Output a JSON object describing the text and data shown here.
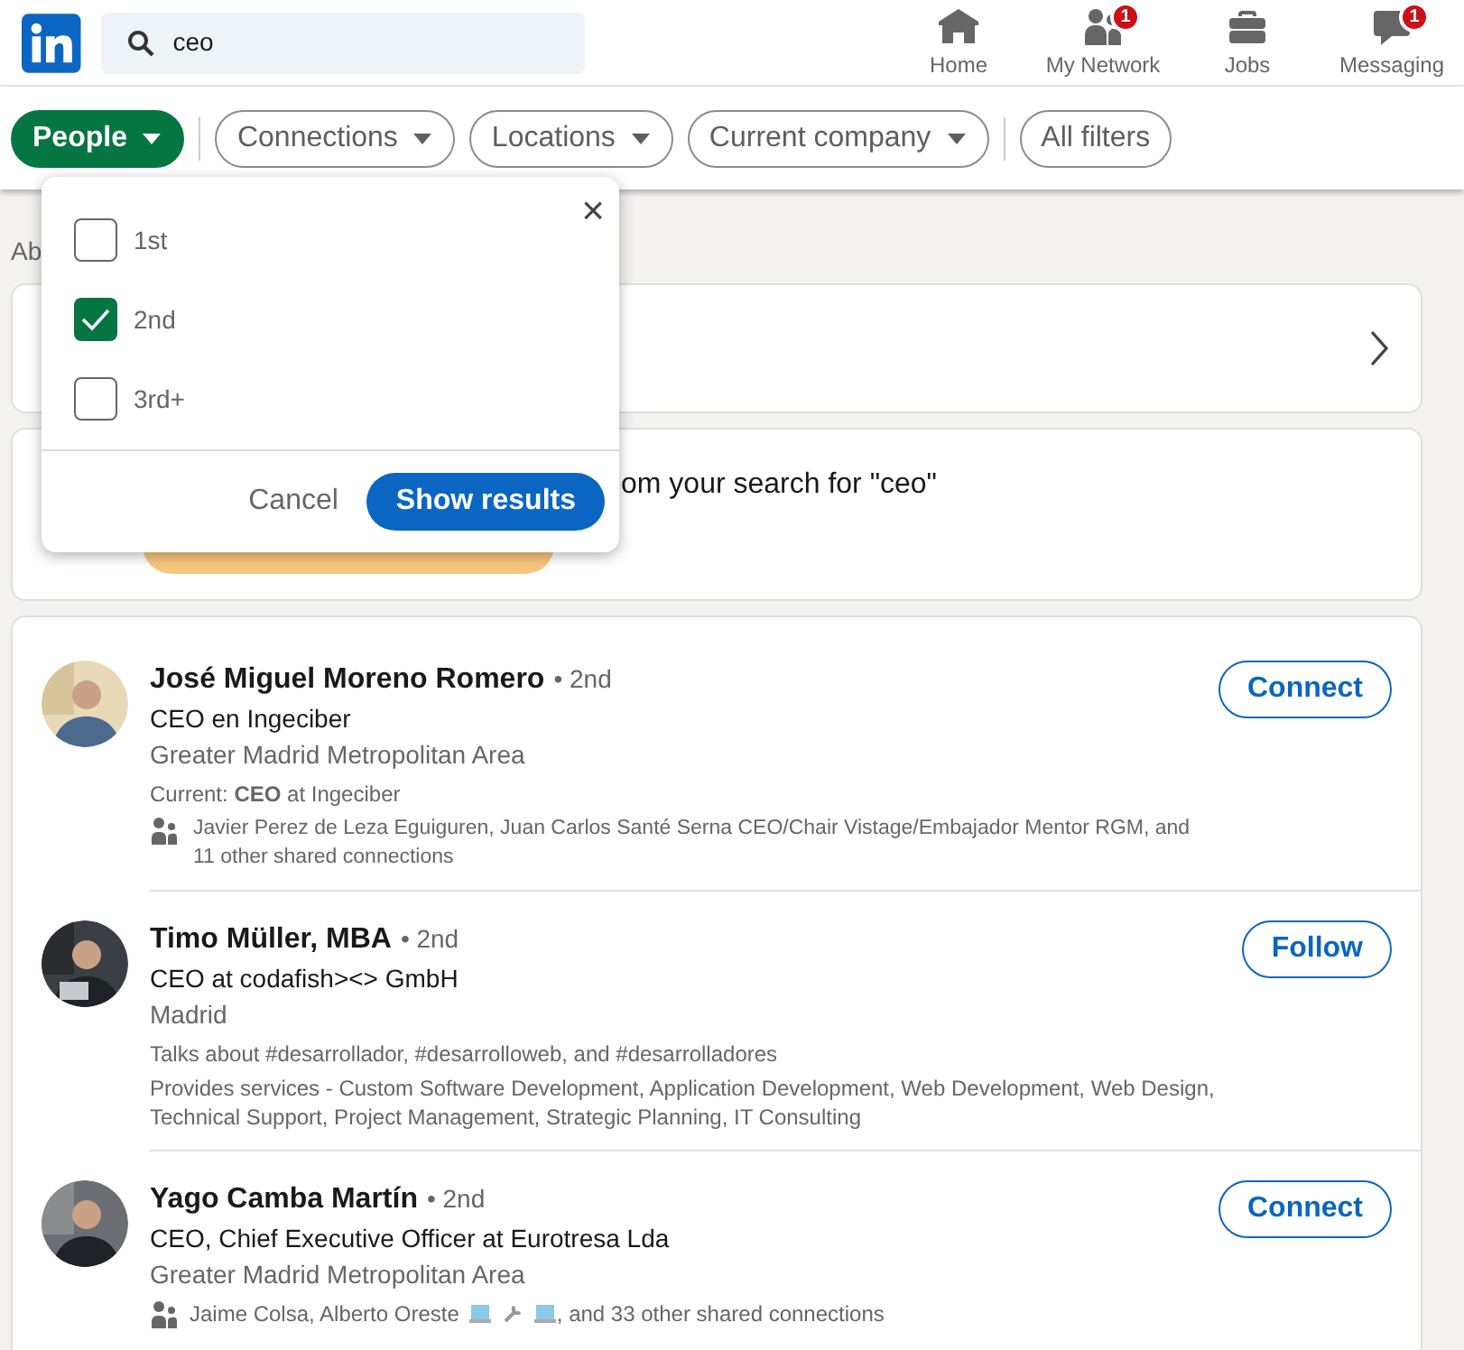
{
  "header": {
    "search": {
      "value": "ceo"
    },
    "nav": [
      {
        "label": "Home"
      },
      {
        "label": "My Network",
        "badge": "1"
      },
      {
        "label": "Jobs"
      },
      {
        "label": "Messaging",
        "badge": "1"
      }
    ]
  },
  "filters": [
    {
      "label": "People",
      "selected": true,
      "caret": true
    },
    {
      "label": "Connections",
      "selected": false,
      "caret": true
    },
    {
      "label": "Locations",
      "selected": false,
      "caret": true
    },
    {
      "label": "Current company",
      "selected": false,
      "caret": true
    },
    {
      "label": "All filters",
      "selected": false,
      "caret": false
    }
  ],
  "dropdown": {
    "close": "×",
    "options": [
      {
        "label": "1st",
        "checked": false
      },
      {
        "label": "2nd",
        "checked": true
      },
      {
        "label": "3rd+",
        "checked": false
      }
    ],
    "cancel": "Cancel",
    "submit": "Show results"
  },
  "results_count_partial": "Ab",
  "promo_text_partial": "om your search for \"ceo\"",
  "results": [
    {
      "name": "José Miguel Moreno Romero",
      "degree": "• 2nd",
      "headline": "CEO en Ingeciber",
      "location": "Greater Madrid Metropolitan Area",
      "action": "Connect",
      "lines": [
        {
          "kind": "current",
          "text": "Current: **CEO** at Ingeciber"
        },
        {
          "kind": "shared",
          "text": "Javier Perez de Leza Eguiguren, Juan Carlos Santé Serna CEO/Chair Vistage/Embajador Mentor RGM, and 11 other shared connections"
        }
      ]
    },
    {
      "name": "Timo Müller, MBA",
      "degree": "• 2nd",
      "headline": "CEO at codafish><> GmbH",
      "location": "Madrid",
      "action": "Follow",
      "lines": [
        {
          "kind": "talks",
          "text": "Talks about #desarrollador, #desarrolloweb, and #desarrolladores"
        },
        {
          "kind": "services",
          "text": "Provides services - Custom Software Development, Application Development, Web Development, Web Design, Technical Support, Project Management, Strategic Planning, IT Consulting"
        }
      ]
    },
    {
      "name": "Yago Camba Martín",
      "degree": "• 2nd",
      "headline": "CEO, Chief Executive Officer at Eurotresa Lda",
      "location": "Greater Madrid Metropolitan Area",
      "action": "Connect",
      "lines": [
        {
          "kind": "shared_icons",
          "before": "Jaime Colsa, Alberto Oreste",
          "after": ", and 33 other shared connections"
        }
      ]
    }
  ]
}
